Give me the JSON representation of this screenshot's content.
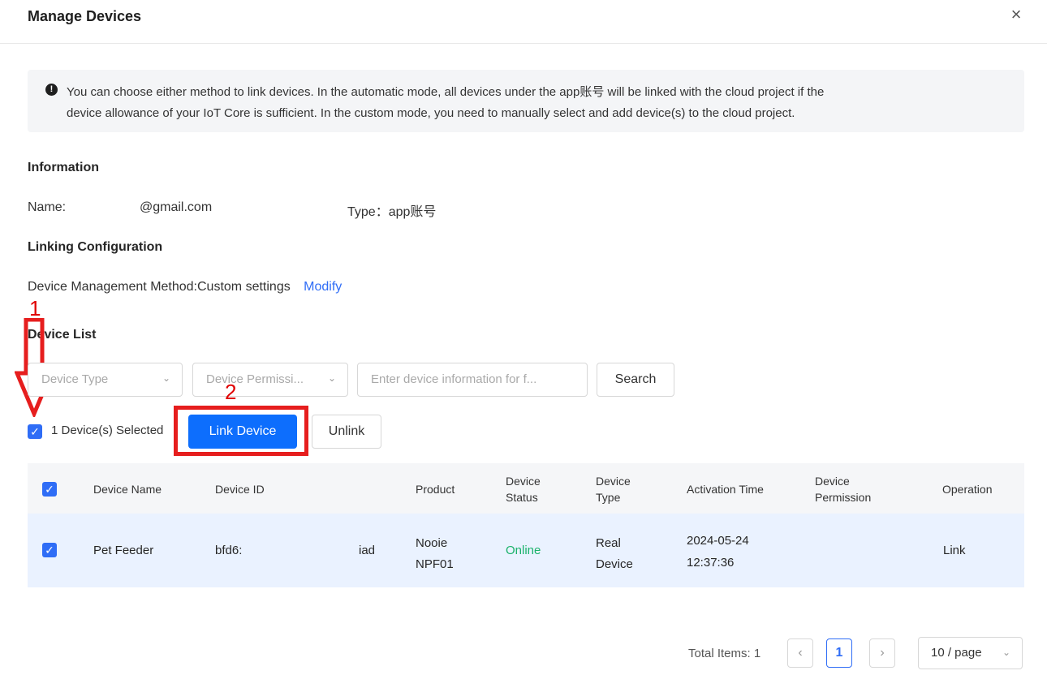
{
  "dialog": {
    "title": "Manage Devices",
    "close_icon": "close-icon"
  },
  "notice": {
    "icon": "info-icon",
    "line1": "You can choose either method to link devices. In the automatic mode, all devices under the app账号 will be linked with the cloud project if the",
    "line2": "device allowance of your IoT Core is sufficient. In the custom mode, you need to manually select and add device(s) to the cloud project."
  },
  "information": {
    "heading": "Information",
    "name_label": "Name:",
    "name_value": "@gmail.com",
    "type_text": "Type：app账号"
  },
  "linking_configuration": {
    "heading": "Linking Configuration",
    "method_text": "Device Management Method:Custom settings",
    "modify_link": "Modify"
  },
  "device_list": {
    "heading": "Device List",
    "filters": {
      "device_type_placeholder": "Device Type",
      "device_permission_placeholder": "Device Permissi...",
      "search_placeholder": "Enter device information for f...",
      "search_button": "Search"
    },
    "selection_text": "1 Device(s) Selected",
    "link_button": "Link Device",
    "unlink_button": "Unlink",
    "table": {
      "headers": {
        "device_name": "Device Name",
        "device_id": "Device ID",
        "product": "Product",
        "device_status_line1": "Device",
        "device_status_line2": "Status",
        "device_type_line1": "Device",
        "device_type_line2": "Type",
        "activation_time": "Activation Time",
        "device_permission_line1": "Device",
        "device_permission_line2": "Permission",
        "operation": "Operation"
      },
      "rows": [
        {
          "device_name": "Pet Feeder",
          "device_id_start": "bfd6:",
          "device_id_end": "iad",
          "product_line1": "Nooie",
          "product_line2": "NPF01",
          "device_status": "Online",
          "device_type_line1": "Real",
          "device_type_line2": "Device",
          "activation_date": "2024-05-24",
          "activation_time": "12:37:36",
          "operation": "Link"
        }
      ]
    }
  },
  "pagination": {
    "total_items": "Total Items: 1",
    "prev_icon": "chevron-left-icon",
    "current_page": "1",
    "next_icon": "chevron-right-icon",
    "page_size": "10 / page"
  },
  "annotations": {
    "step_1": "1",
    "step_2": "2",
    "arrow_icon": "down-arrow-icon"
  },
  "colors": {
    "accent": "#2f6df6",
    "primary_button": "#0d6efd",
    "online": "#1ab26b",
    "annotation_red": "#e61e1e"
  }
}
